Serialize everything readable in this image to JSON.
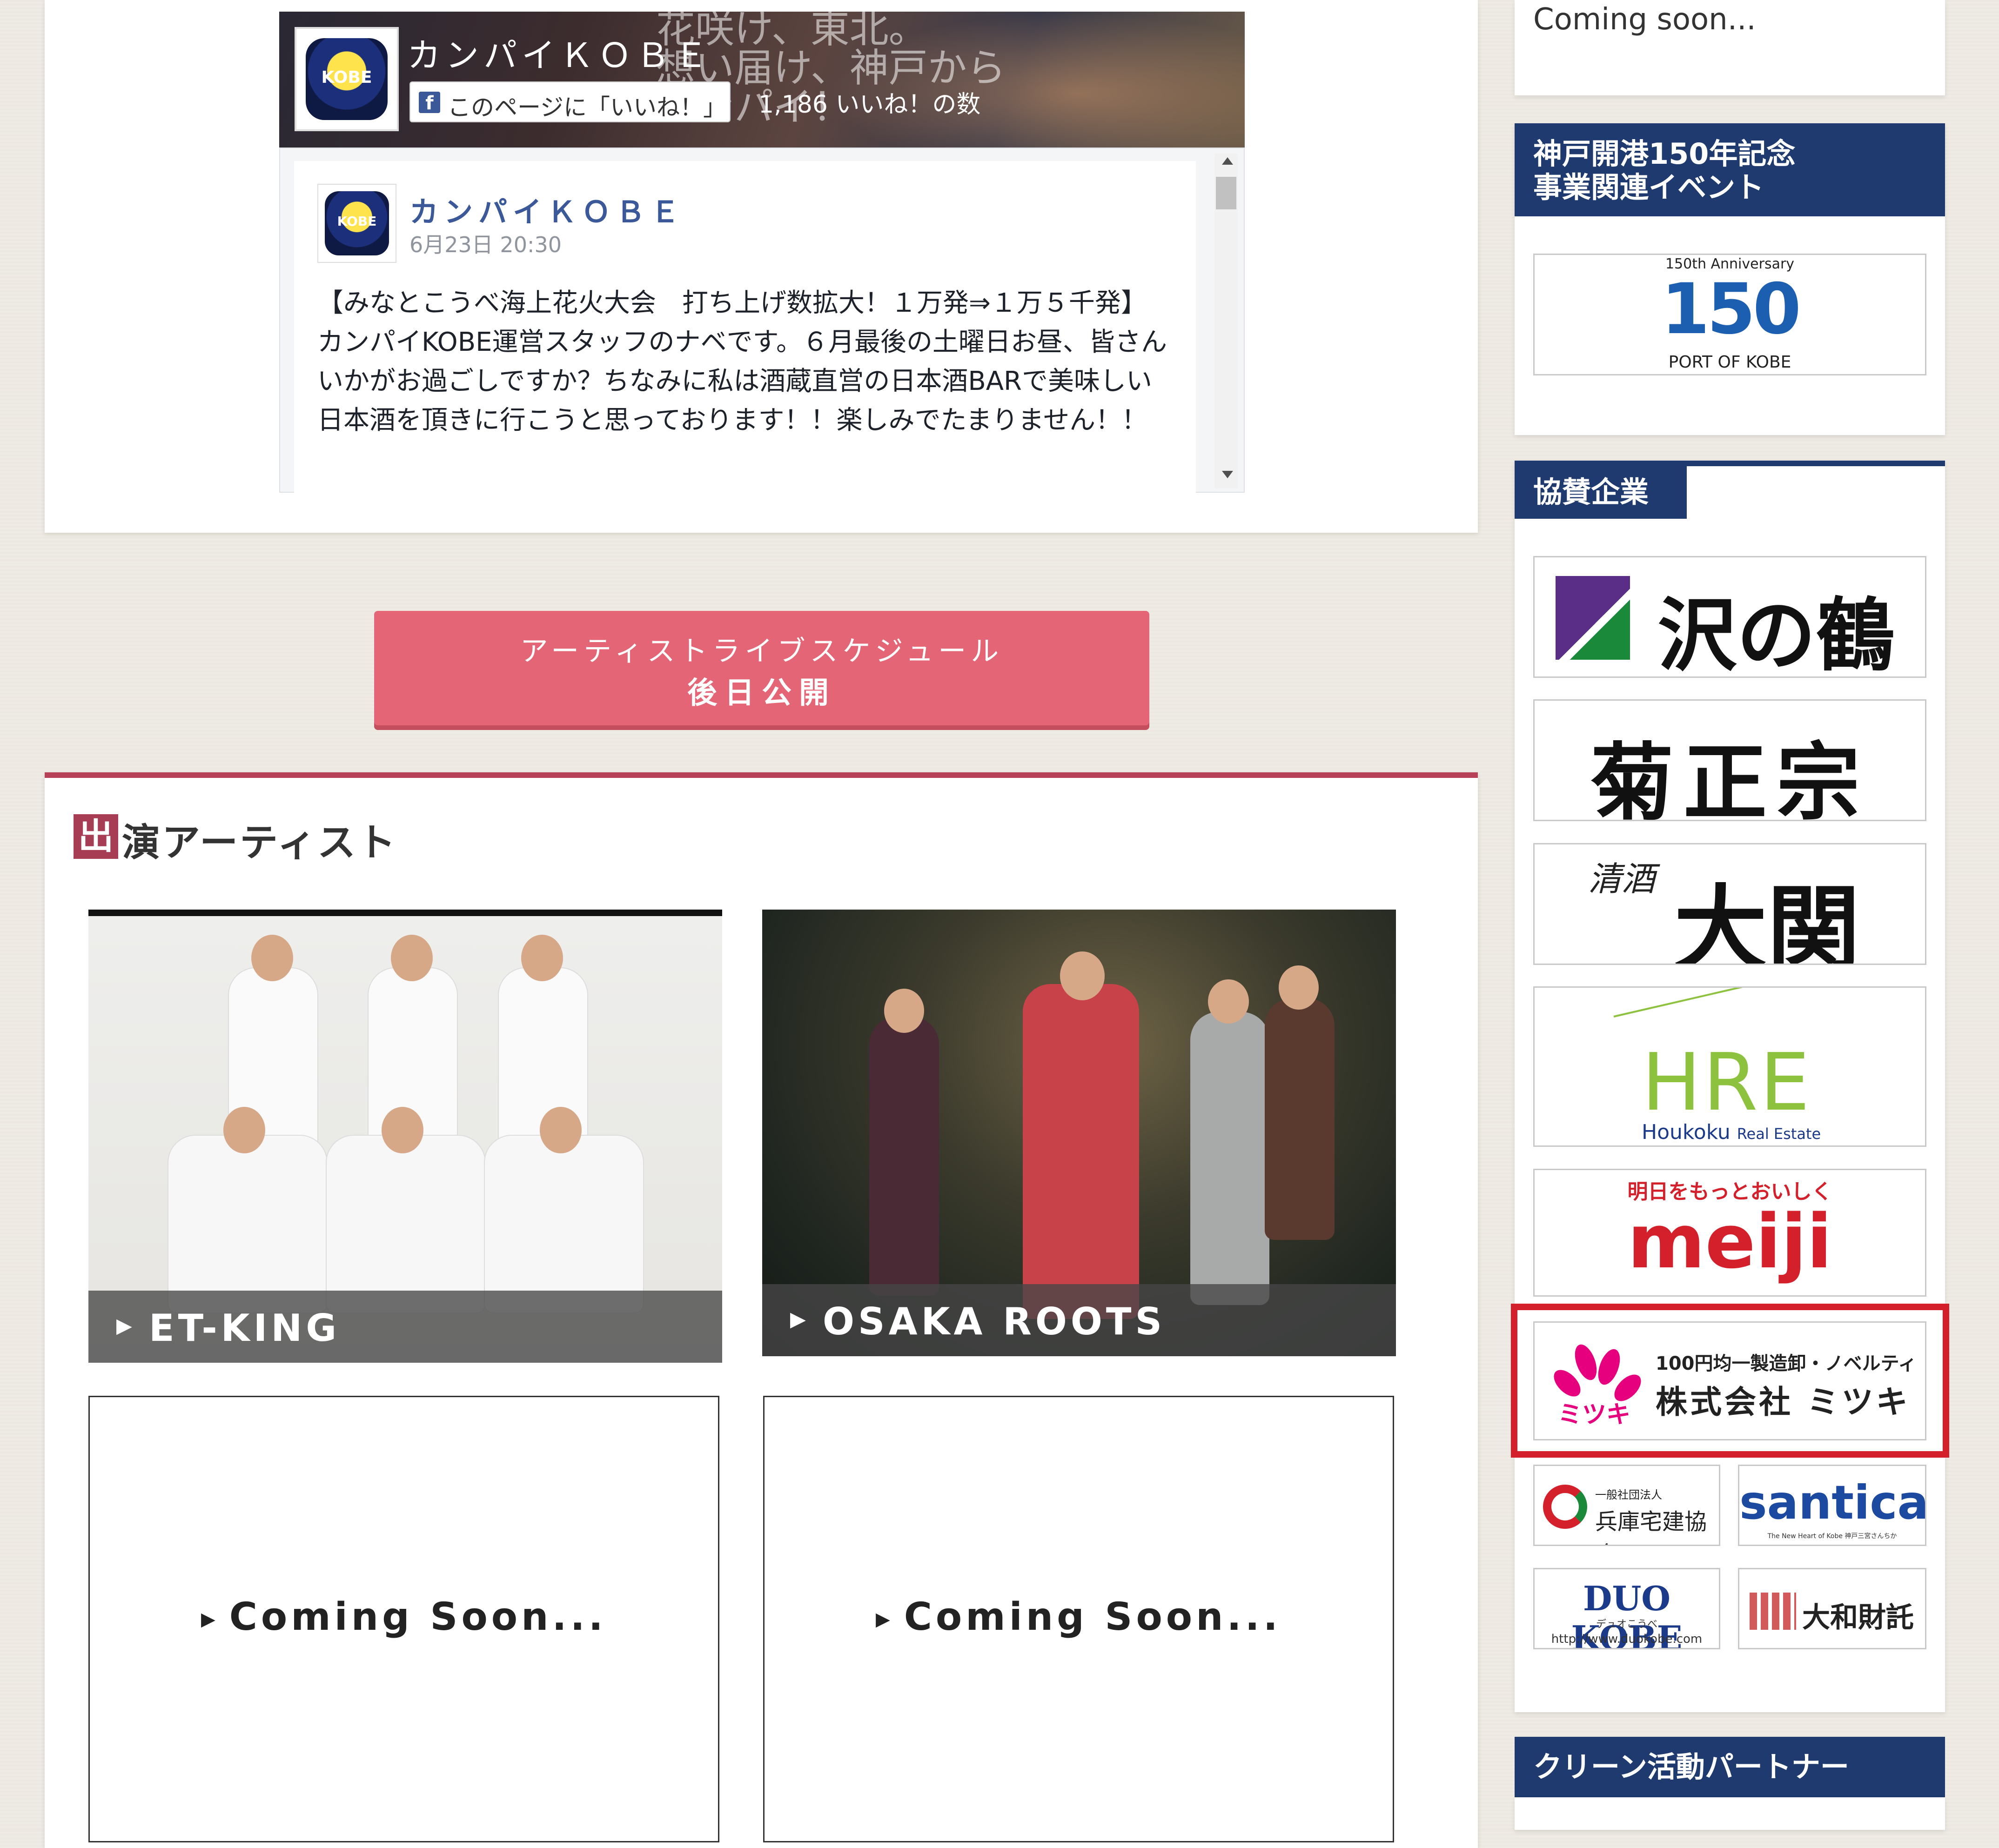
{
  "colors": {
    "accent_red": "#b8415a",
    "button_pink": "#e46576",
    "navy": "#1e3a6e",
    "highlight_red": "#d3202b"
  },
  "facebook": {
    "page_name": "カンパイＫＯＢＥ",
    "like_button": "このページに「いいね！」",
    "like_count": "1,186 いいね！の数",
    "cover_text": "花咲け、東北。\n想い届け、神戸から\nカンパイ！",
    "logo_text": "KOBE",
    "post": {
      "author": "カンパイＫＯＢＥ",
      "date": "6月23日 20:30",
      "text": "【みなとこうべ海上花火大会　打ち上げ数拡大！１万発⇒１万５千発】\nカンパイKOBE運営スタッフのナベです。６月最後の土曜日お昼、皆さんいかがお過ごしですか？ちなみに私は酒蔵直営の日本酒BARで美味しい日本酒を頂きに行こうと思っております！！楽しみでたまりません！！"
    }
  },
  "schedule_button": {
    "line1": "アーティストライブスケジュール",
    "line2": "後日公開"
  },
  "artists": {
    "heading_first": "出",
    "heading_rest": "演アーティスト",
    "cards": [
      {
        "label": "ET-KING",
        "icon": "play-triangle-icon"
      },
      {
        "label": "OSAKA ROOTS",
        "icon": "play-triangle-icon"
      },
      {
        "label": "Coming Soon...",
        "icon": "play-triangle-icon"
      },
      {
        "label": "Coming Soon...",
        "icon": "play-triangle-icon"
      }
    ]
  },
  "sidebar": {
    "coming_soon": "Coming soon...",
    "port_heading_line1": "神戸開港150年記念",
    "port_heading_line2": "事業関連イベント",
    "port_logo": {
      "top": "150th Anniversary",
      "num": "150",
      "bottom": "PORT OF KOBE"
    },
    "sponsor_heading": "協賛企業",
    "sponsors": {
      "sawanotsuru": "沢の鶴",
      "kikumasamune": "菊正宗",
      "ozeki_small": "清酒",
      "ozeki": "大関",
      "houkoku_mark": "HRE",
      "houkoku_name": "Houkoku",
      "houkoku_sub": "Real Estate",
      "meiji_tag": "明日をもっとおいしく",
      "meiji": "meiji",
      "mitsuki_top": "100円均一製造卸・ノベルティ",
      "mitsuki_name": "株式会社 ミツキ",
      "mitsuki_mark": "ミツキ",
      "takken_small": "一般社団法人",
      "takken": "兵庫宅建協会",
      "santica": "santica",
      "santica_sub": "The New Heart of Kobe 神戸三宮さんちか",
      "duo": "DUO KOBE",
      "duo_sub": "デュオこうべ",
      "duo_url": "http://www.duokobe.com",
      "daiwa": "大和財託"
    },
    "clean_heading": "クリーン活動パートナー"
  }
}
